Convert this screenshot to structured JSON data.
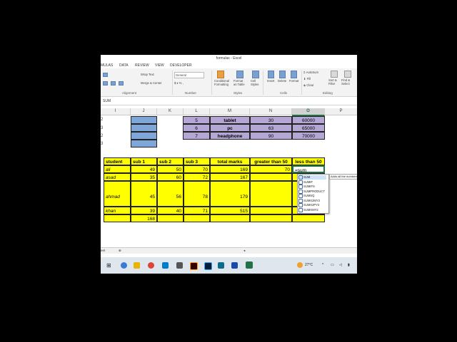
{
  "window": {
    "title": "formulas - Excel"
  },
  "ribbon_tabs": [
    "MULAS",
    "DATA",
    "REVIEW",
    "VIEW",
    "DEVELOPER"
  ],
  "ribbon": {
    "wrap_text": "Wrap Text",
    "merge_center": "Merge & Center",
    "number_format": "General",
    "conditional": "Conditional Formatting",
    "format_table": "Format as Table",
    "cell_styles": "Cell Styles",
    "insert": "Insert",
    "delete": "Delete",
    "format": "Format",
    "autosum": "AutoSum",
    "fill": "Fill",
    "clear": "Clear",
    "sort": "Sort & Filter",
    "find": "Find & Select",
    "groups": {
      "alignment": "Alignment",
      "number": "Number",
      "styles": "Styles",
      "cells": "Cells",
      "editing": "Editing"
    }
  },
  "formula_bar": {
    "name_box": "SUM"
  },
  "columns": [
    "I",
    "J",
    "K",
    "L",
    "M",
    "N",
    "O",
    "P"
  ],
  "row_fragments": [
    "2",
    "3",
    "2",
    "3"
  ],
  "products": [
    {
      "id": "5",
      "name": "tablet",
      "qty": "30",
      "price": "60000"
    },
    {
      "id": "6",
      "name": "pc",
      "qty": "63",
      "price": "65000"
    },
    {
      "id": "7",
      "name": "headphone",
      "qty": "90",
      "price": "70000"
    }
  ],
  "table": {
    "headers": [
      "student",
      "sub 1",
      "sub 2",
      "sub 3",
      "total marks",
      "greater than 50",
      "less than 50"
    ],
    "rows": [
      {
        "student": "ali",
        "sub1": "49",
        "sub2": "50",
        "sub3": "70",
        "total": "169",
        "gt50": "70",
        "lt50": "=sum"
      },
      {
        "student": "asad",
        "sub1": "35",
        "sub2": "60",
        "sub3": "72",
        "total": "167",
        "gt50": "",
        "lt50": ""
      },
      {
        "student": "ahmad",
        "sub1": "45",
        "sub2": "56",
        "sub3": "78",
        "total": "179",
        "gt50": "",
        "lt50": ""
      },
      {
        "student": "khan",
        "sub1": "39",
        "sub2": "40",
        "sub3": "71",
        "total": "515",
        "gt50": "",
        "lt50": ""
      }
    ],
    "extra": "168"
  },
  "autocomplete": {
    "items": [
      "SUM",
      "SUMIF",
      "SUMIFS",
      "SUMPRODUCT",
      "SUMSQ",
      "SUMX2MY2",
      "SUMX2PY2",
      "SUMXMY2"
    ],
    "tooltip": "Adds all the numbers"
  },
  "sheet_tab": "eet",
  "taskbar": {
    "temperature": "27°C"
  },
  "colors": {
    "yellow": "#ffff00",
    "purple": "#b4a7d6",
    "blue": "#7ea6d8",
    "excel_green": "#217346"
  }
}
